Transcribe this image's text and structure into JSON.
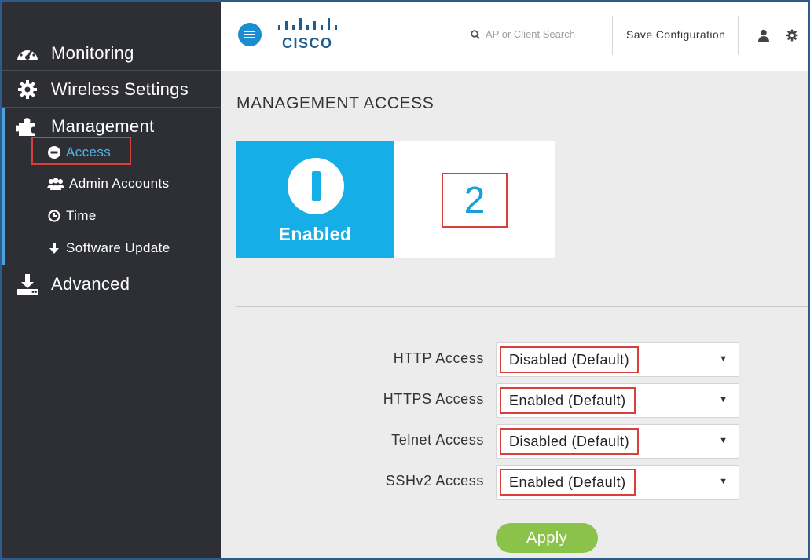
{
  "sidebar": {
    "items": [
      {
        "label": "Monitoring",
        "icon": "dashboard-icon"
      },
      {
        "label": "Wireless Settings",
        "icon": "gear-icon"
      },
      {
        "label": "Management",
        "icon": "puzzle-icon"
      },
      {
        "label": "Advanced",
        "icon": "download-icon"
      }
    ],
    "management_sub": [
      {
        "label": "Access",
        "icon": "minus-circle-icon"
      },
      {
        "label": "Admin Accounts",
        "icon": "users-icon"
      },
      {
        "label": "Time",
        "icon": "clock-icon"
      },
      {
        "label": "Software Update",
        "icon": "arrow-down-icon"
      }
    ]
  },
  "header": {
    "logo_text": "CISCO",
    "search_placeholder": "AP or Client Search",
    "save_label": "Save Configuration"
  },
  "main": {
    "title": "MANAGEMENT ACCESS",
    "status_tile": {
      "label": "Enabled",
      "count": "2"
    },
    "rows": [
      {
        "label": "HTTP Access",
        "value": "Disabled (Default)"
      },
      {
        "label": "HTTPS Access",
        "value": "Enabled (Default)"
      },
      {
        "label": "Telnet Access",
        "value": "Disabled (Default)"
      },
      {
        "label": "SSHv2 Access",
        "value": "Enabled (Default)"
      }
    ],
    "apply_label": "Apply"
  },
  "colors": {
    "sidebar_bg": "#2e2f35",
    "accent_blue": "#15aee6",
    "highlight_red": "#d9403b",
    "apply_green": "#8bc34a"
  }
}
